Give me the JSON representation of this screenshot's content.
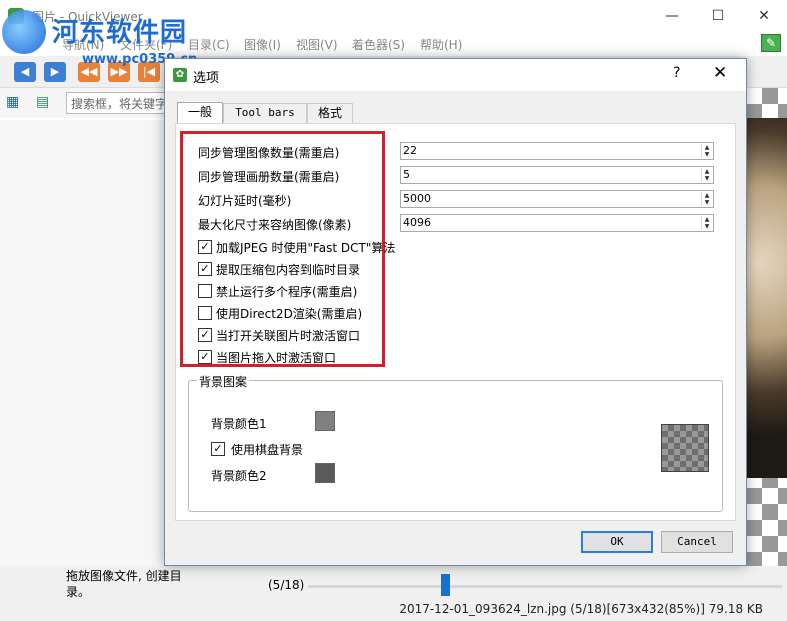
{
  "window": {
    "title": "图片 - QuickViewer",
    "min": "—",
    "max": "☐",
    "close": "✕"
  },
  "watermark": {
    "text": "河东软件园",
    "url": "www.pc0359.cn"
  },
  "menu": [
    "导航(N)",
    "文件夹(F)",
    "目录(C)",
    "图像(I)",
    "视图(V)",
    "着色器(S)",
    "帮助(H)"
  ],
  "toolbar": {
    "buttons": [
      "◀",
      "▶",
      "◀◀",
      "▶▶",
      "|◀"
    ]
  },
  "search": {
    "placeholder": "搜索框，将关键字"
  },
  "dialog": {
    "title": "选项",
    "help": "?",
    "close": "✕",
    "tabs": [
      "一般",
      "Tool bars",
      "格式"
    ],
    "fields": [
      {
        "label": "同步管理图像数量(需重启)",
        "value": "22"
      },
      {
        "label": "同步管理画册数量(需重启)",
        "value": "5"
      },
      {
        "label": "幻灯片延时(毫秒)",
        "value": "5000"
      },
      {
        "label": "最大化尺寸来容纳图像(像素)",
        "value": "4096"
      }
    ],
    "checkboxes": [
      {
        "label": "加载JPEG 时使用\"Fast DCT\"算法",
        "checked": true,
        "mark": "✓"
      },
      {
        "label": "提取压缩包内容到临时目录",
        "checked": true,
        "mark": "✓"
      },
      {
        "label": "禁止运行多个程序(需重启)",
        "checked": false,
        "mark": ""
      },
      {
        "label": "使用Direct2D渲染(需重启)",
        "checked": false,
        "mark": ""
      },
      {
        "label": "当打开关联图片时激活窗口",
        "checked": true,
        "mark": "✓"
      },
      {
        "label": "当图片拖入时激活窗口",
        "checked": true,
        "mark": "✓"
      }
    ],
    "background": {
      "group_title": "背景图案",
      "color1_label": "背景颜色1",
      "color1": "#808080",
      "checker_label": "使用棋盘背景",
      "checker_mark": "✓",
      "color2_label": "背景颜色2",
      "color2": "#5a5a5a"
    },
    "ok": "OK",
    "cancel": "Cancel"
  },
  "status": {
    "hint": "拖放图像文件, 创建目录。",
    "count": "(5/18)",
    "progress": 0.28,
    "file_info": "2017-12-01_093624_lzn.jpg (5/18)[673x432(85%)] 79.18 KB"
  }
}
